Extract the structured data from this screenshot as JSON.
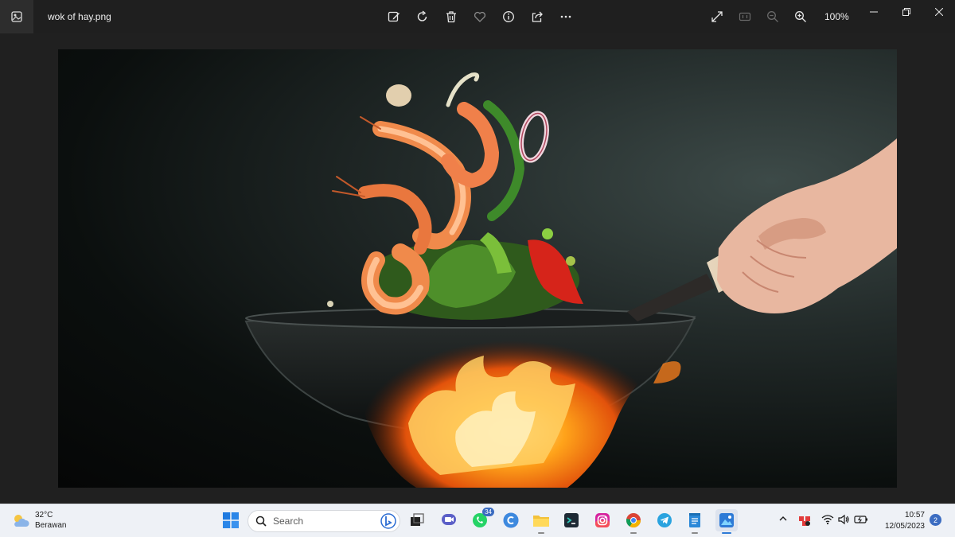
{
  "window": {
    "file_name": "wok of hay.png",
    "zoom_level": "100%",
    "toolbar_icons": [
      "edit-image-icon",
      "rotate-icon",
      "delete-icon",
      "favorite-icon",
      "info-icon",
      "share-icon",
      "more-icon"
    ],
    "right_icons": [
      "fullscreen-icon",
      "actual-size-icon",
      "zoom-out-icon",
      "zoom-in-icon"
    ]
  },
  "image": {
    "subject": "wok with shrimp and vegetables over flames"
  },
  "taskbar": {
    "weather_temp": "32°C",
    "weather_desc": "Berawan",
    "search_placeholder": "Search",
    "whatsapp_badge": "34",
    "clock_time": "10:57",
    "clock_date": "12/05/2023",
    "notification_count": "2"
  },
  "colors": {
    "titlebar": "#1f1f1f",
    "taskbar": "#eef1f6",
    "accent": "#3b6cc1"
  }
}
